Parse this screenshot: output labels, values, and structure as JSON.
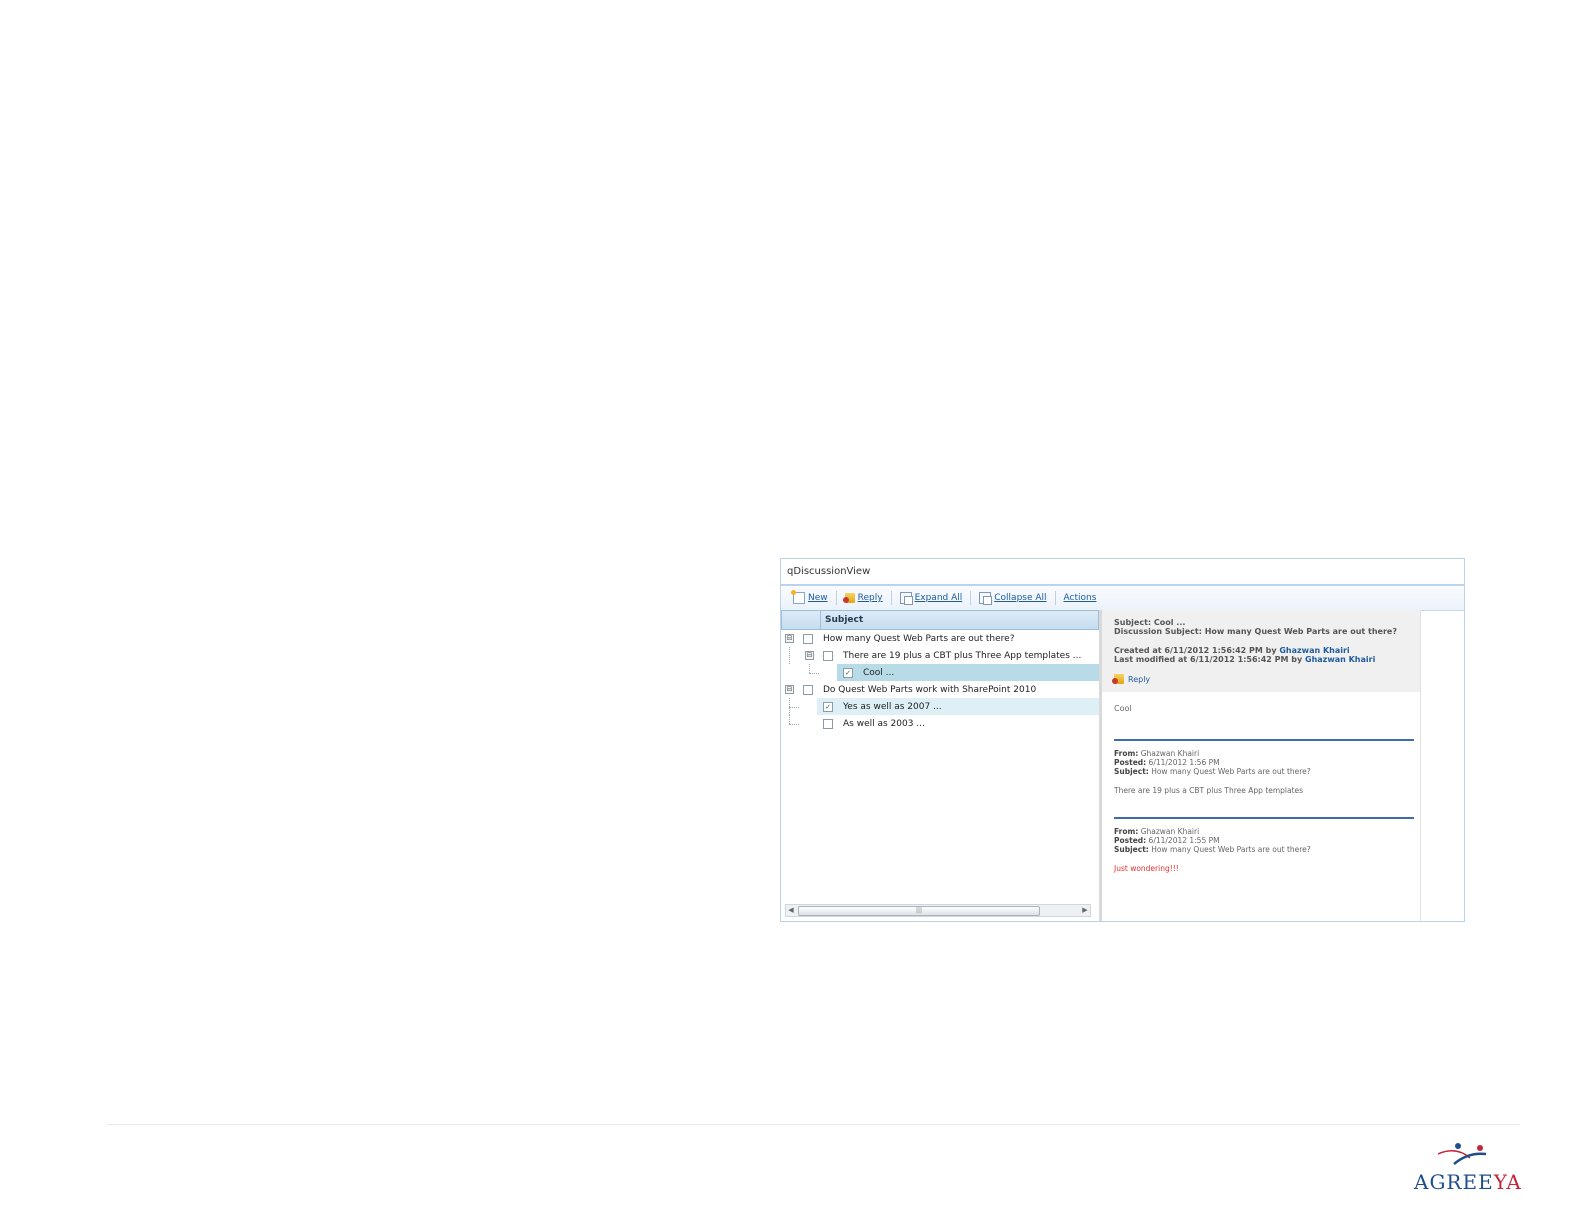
{
  "webpart": {
    "title": "qDiscussionView",
    "toolbar": {
      "new": "New",
      "reply": "Reply",
      "expand_all": "Expand All",
      "collapse_all": "Collapse All",
      "actions": "Actions"
    },
    "tree": {
      "header": "Subject",
      "rows": [
        {
          "text": "How many Quest Web Parts are out there?",
          "level": 0,
          "expander": "⊟",
          "checked": false
        },
        {
          "text": "There are 19 plus a CBT plus Three App templates ...",
          "level": 1,
          "expander": "⊟",
          "checked": false
        },
        {
          "text": "Cool ...",
          "level": 2,
          "checked": true,
          "selected": true
        },
        {
          "text": "Do Quest Web Parts work with SharePoint 2010",
          "level": 0,
          "expander": "⊟",
          "checked": false
        },
        {
          "text": "Yes as well as 2007 ...",
          "level": 1,
          "checked": true,
          "highlight": true
        },
        {
          "text": "As well as 2003 ...",
          "level": 1,
          "checked": false
        }
      ]
    },
    "detail": {
      "subject_line": "Subject: Cool ...",
      "discussion_subject": "Discussion Subject: How many Quest Web Parts are out there?",
      "created_prefix": "Created at 6/11/2012 1:56:42 PM by ",
      "created_author": "Ghazwan Khairi",
      "modified_prefix": "Last modified at 6/11/2012 1:56:42 PM by ",
      "modified_author": "Ghazwan Khairi",
      "reply_label": "Reply",
      "body": "Cool",
      "messages": [
        {
          "from_label": "From:",
          "from": "Ghazwan Khairi",
          "posted_label": "Posted:",
          "posted": "6/11/2012 1:56 PM",
          "subject_label": "Subject:",
          "subject": "How many Quest Web Parts are out there?",
          "body": "There are 19 plus a CBT plus Three App templates"
        },
        {
          "from_label": "From:",
          "from": "Ghazwan Khairi",
          "posted_label": "Posted:",
          "posted": "6/11/2012 1:55 PM",
          "subject_label": "Subject:",
          "subject": "How many Quest Web Parts are out there?",
          "body": "Just wondering!!!"
        }
      ]
    }
  },
  "footer": {
    "logo_text_1": "AGREE",
    "logo_text_2": "YA"
  },
  "colors": {
    "accent_blue": "#1f5a9c",
    "selection": "#b7dce8",
    "separator_blue": "#3d6cb0",
    "alert_red": "#e0302e"
  }
}
